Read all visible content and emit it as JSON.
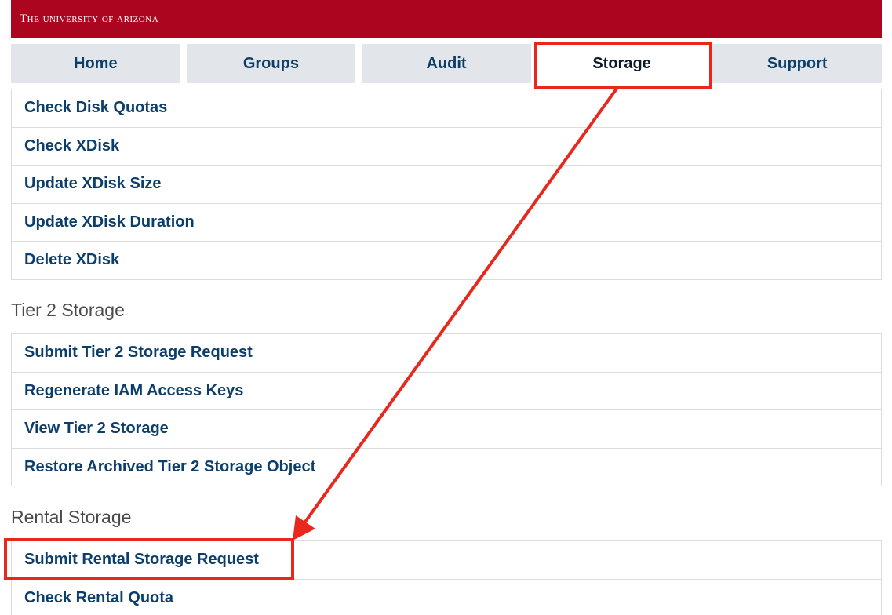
{
  "banner": {
    "title": "The University of Arizona"
  },
  "tabs": [
    {
      "label": "Home",
      "active": false
    },
    {
      "label": "Groups",
      "active": false
    },
    {
      "label": "Audit",
      "active": false
    },
    {
      "label": "Storage",
      "active": true
    },
    {
      "label": "Support",
      "active": false
    }
  ],
  "storage_items": [
    "Check Disk Quotas",
    "Check XDisk",
    "Update XDisk Size",
    "Update XDisk Duration",
    "Delete XDisk"
  ],
  "tier2": {
    "heading": "Tier 2 Storage",
    "items": [
      "Submit Tier 2 Storage Request",
      "Regenerate IAM Access Keys",
      "View Tier 2 Storage",
      "Restore Archived Tier 2 Storage Object"
    ]
  },
  "rental": {
    "heading": "Rental Storage",
    "items": [
      "Submit Rental Storage Request",
      "Check Rental Quota"
    ]
  },
  "colors": {
    "banner": "#ab0520",
    "link": "#0c3e6b",
    "annotation": "#e8281c"
  }
}
